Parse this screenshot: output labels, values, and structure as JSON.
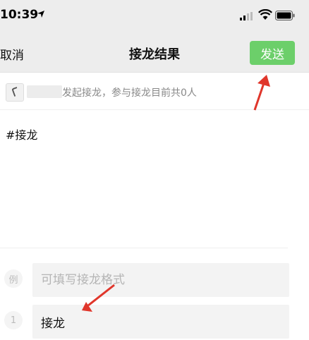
{
  "status": {
    "time": "10:39"
  },
  "nav": {
    "cancel": "取消",
    "title": "接龙结果",
    "send": "发送"
  },
  "info": {
    "text": "发起接龙，参与接龙目前共0人"
  },
  "content": {
    "text": "#接龙"
  },
  "example": {
    "label": "例",
    "placeholder": "可填写接龙格式"
  },
  "entries": [
    {
      "label": "1",
      "value": "接龙"
    }
  ],
  "colors": {
    "send_button": "#6ccf6a",
    "bar_background": "#ededed",
    "arrow": "#e0362b"
  }
}
